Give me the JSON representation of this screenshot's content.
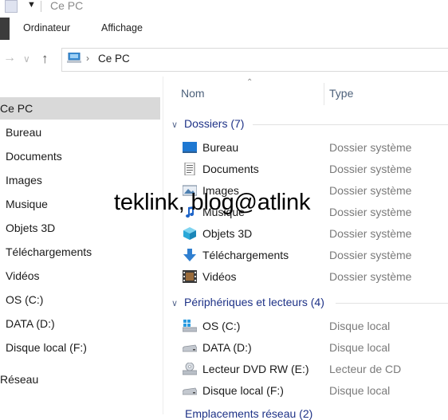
{
  "window": {
    "title": "Ce PC"
  },
  "ribbon": {
    "tabs": [
      "Ordinateur",
      "Affichage"
    ]
  },
  "address": {
    "crumb": "Ce PC"
  },
  "sidebar": {
    "items": [
      {
        "label": "Ce PC",
        "selected": true
      },
      {
        "label": "Bureau"
      },
      {
        "label": "Documents"
      },
      {
        "label": "Images"
      },
      {
        "label": "Musique"
      },
      {
        "label": "Objets 3D"
      },
      {
        "label": "Téléchargements"
      },
      {
        "label": "Vidéos"
      },
      {
        "label": "OS (C:)"
      },
      {
        "label": "DATA (D:)"
      },
      {
        "label": "Disque local (F:)"
      },
      {
        "label": "Réseau"
      }
    ]
  },
  "columns": {
    "name": "Nom",
    "type": "Type"
  },
  "groups": [
    {
      "title": "Dossiers (7)",
      "items": [
        {
          "name": "Bureau",
          "type": "Dossier système",
          "icon": "desktop-icon"
        },
        {
          "name": "Documents",
          "type": "Dossier système",
          "icon": "documents-icon"
        },
        {
          "name": "Images",
          "type": "Dossier système",
          "icon": "images-icon"
        },
        {
          "name": "Musique",
          "type": "Dossier système",
          "icon": "music-icon"
        },
        {
          "name": "Objets 3D",
          "type": "Dossier système",
          "icon": "objects-3d-icon"
        },
        {
          "name": "Téléchargements",
          "type": "Dossier système",
          "icon": "downloads-icon"
        },
        {
          "name": "Vidéos",
          "type": "Dossier système",
          "icon": "videos-icon"
        }
      ]
    },
    {
      "title": "Périphériques et lecteurs (4)",
      "items": [
        {
          "name": "OS (C:)",
          "type": "Disque local",
          "icon": "windows-drive-icon"
        },
        {
          "name": "DATA (D:)",
          "type": "Disque local",
          "icon": "drive-icon"
        },
        {
          "name": "Lecteur DVD RW (E:)",
          "type": "Lecteur de CD",
          "icon": "dvd-drive-icon"
        },
        {
          "name": "Disque local (F:)",
          "type": "Disque local",
          "icon": "drive-icon"
        }
      ]
    }
  ],
  "cut_group": "Emplacements réseau (2)",
  "watermark": "teklink, blog@atlink",
  "colors": {
    "group_title": "#1e3287",
    "selection": "#d9d9d9",
    "type_text": "#7a7a7a"
  }
}
